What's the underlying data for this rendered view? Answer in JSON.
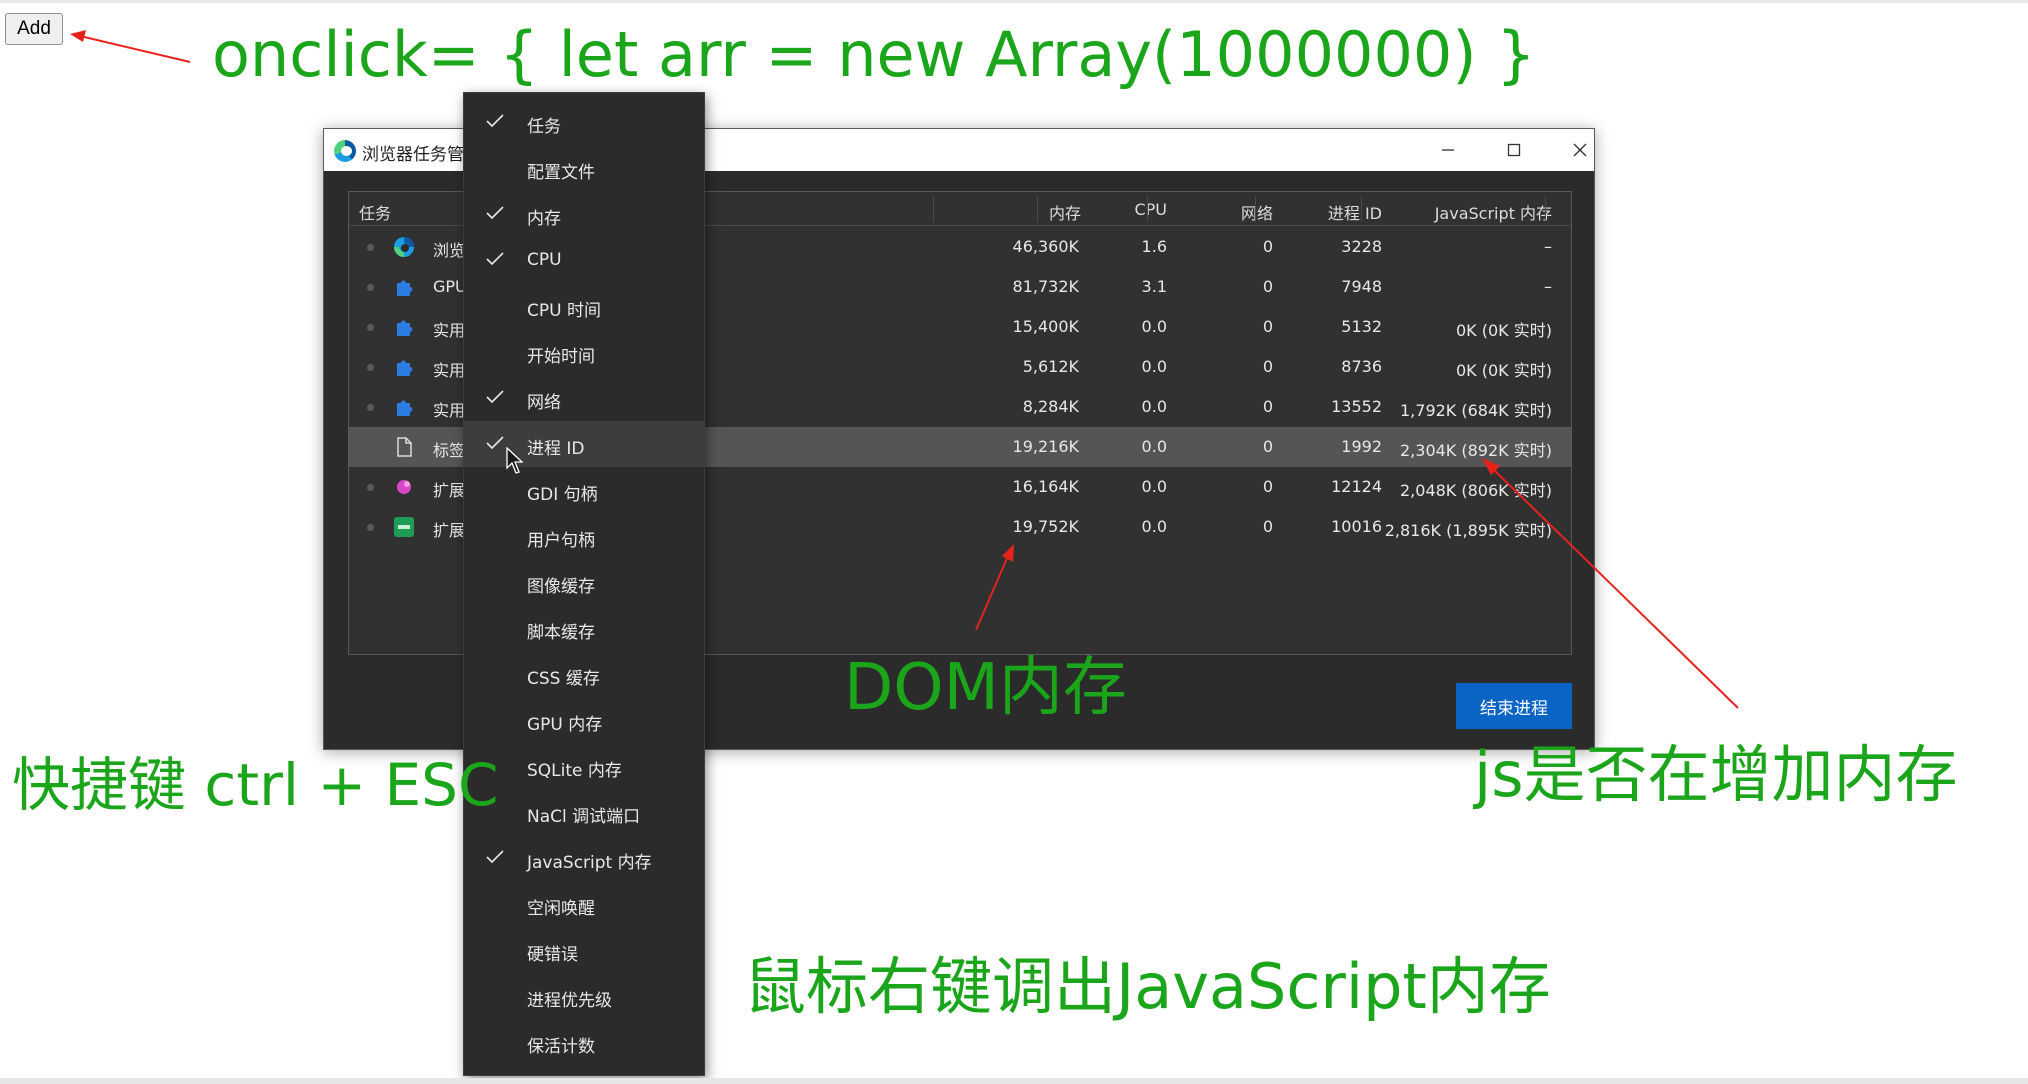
{
  "page": {
    "add_button": "Add",
    "annotations": {
      "onclick_code": "onclick= { let arr = new Array(1000000) }",
      "shortcut": "快捷键 ctrl + ESC",
      "dom_memory": "DOM内存",
      "js_memory": "js是否在增加内存",
      "right_click_hint": "鼠标右键调出JavaScript内存"
    },
    "annotation_color": "#1aa51a",
    "arrow_color": "#e8221b"
  },
  "task_manager": {
    "title": "浏览器任务管",
    "columns": {
      "task": "任务",
      "memory": "内存",
      "cpu": "CPU",
      "network": "网络",
      "pid": "进程 ID",
      "js_memory": "JavaScript 内存"
    },
    "rows": [
      {
        "name": "浏览",
        "icon": "edge-icon",
        "memory": "46,360K",
        "cpu": "1.6",
        "network": "0",
        "pid": "3228",
        "js_memory": "–"
      },
      {
        "name": "GPU",
        "icon": "puzzle-icon",
        "memory": "81,732K",
        "cpu": "3.1",
        "network": "0",
        "pid": "7948",
        "js_memory": "–"
      },
      {
        "name": "实用",
        "icon": "puzzle-icon",
        "memory": "15,400K",
        "cpu": "0.0",
        "network": "0",
        "pid": "5132",
        "js_memory": "0K (0K 实时)"
      },
      {
        "name": "实用",
        "icon": "puzzle-icon",
        "memory": "5,612K",
        "cpu": "0.0",
        "network": "0",
        "pid": "8736",
        "js_memory": "0K (0K 实时)"
      },
      {
        "name": "实用",
        "icon": "puzzle-icon",
        "memory": "8,284K",
        "cpu": "0.0",
        "network": "0",
        "pid": "13552",
        "js_memory": "1,792K (684K 实时)"
      },
      {
        "name": "标签",
        "icon": "page-icon",
        "memory": "19,216K",
        "cpu": "0.0",
        "network": "0",
        "pid": "1992",
        "js_memory": "2,304K (892K 实时)",
        "selected": true
      },
      {
        "name": "扩展",
        "icon": "extension-pink-icon",
        "memory": "16,164K",
        "cpu": "0.0",
        "network": "0",
        "pid": "12124",
        "js_memory": "2,048K (806K 实时)"
      },
      {
        "name": "扩展",
        "icon": "extension-green-icon",
        "memory": "19,752K",
        "cpu": "0.0",
        "network": "0",
        "pid": "10016",
        "js_memory": "2,816K (1,895K 实时)"
      }
    ],
    "end_process": "结束进程"
  },
  "context_menu": {
    "items": [
      {
        "label": "任务",
        "checked": true
      },
      {
        "label": "配置文件",
        "checked": false
      },
      {
        "label": "内存",
        "checked": true
      },
      {
        "label": "CPU",
        "checked": true
      },
      {
        "label": "CPU 时间",
        "checked": false
      },
      {
        "label": "开始时间",
        "checked": false
      },
      {
        "label": "网络",
        "checked": true
      },
      {
        "label": "进程 ID",
        "checked": true,
        "hover": true
      },
      {
        "label": "GDI 句柄",
        "checked": false
      },
      {
        "label": "用户句柄",
        "checked": false
      },
      {
        "label": "图像缓存",
        "checked": false
      },
      {
        "label": "脚本缓存",
        "checked": false
      },
      {
        "label": "CSS 缓存",
        "checked": false
      },
      {
        "label": "GPU 内存",
        "checked": false
      },
      {
        "label": "SQLite 内存",
        "checked": false
      },
      {
        "label": "NaCl 调试端口",
        "checked": false
      },
      {
        "label": "JavaScript 内存",
        "checked": true
      },
      {
        "label": "空闲唤醒",
        "checked": false
      },
      {
        "label": "硬错误",
        "checked": false
      },
      {
        "label": "进程优先级",
        "checked": false
      },
      {
        "label": "保活计数",
        "checked": false
      }
    ]
  }
}
